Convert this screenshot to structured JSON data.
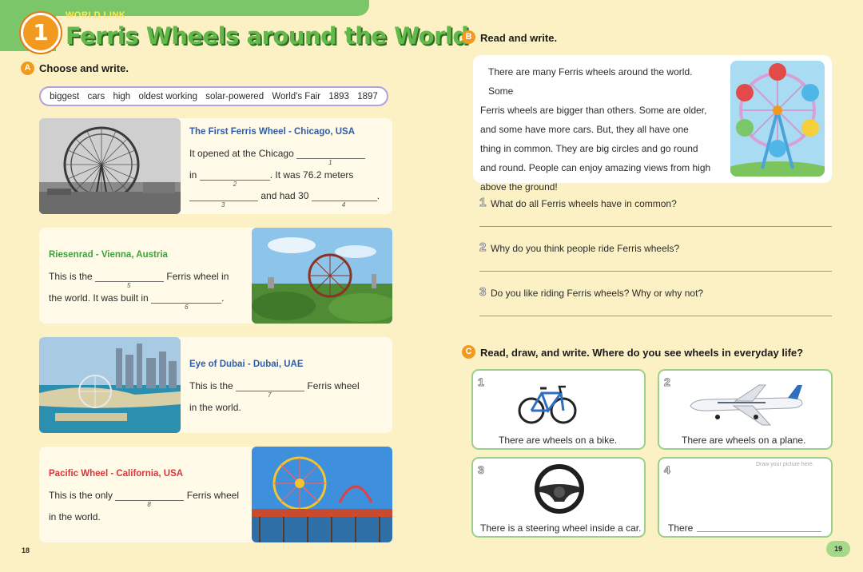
{
  "header": {
    "unit_number": "1",
    "series_label": "WORLD LINK",
    "title": "Ferris Wheels around the World"
  },
  "section_a": {
    "letter": "A",
    "instruction": "Choose and write."
  },
  "word_bank": [
    "biggest",
    "cars",
    "high",
    "oldest working",
    "solar-powered",
    "World's Fair",
    "1893",
    "1897"
  ],
  "cards": {
    "chicago": {
      "title": "The First Ferris Wheel - Chicago, USA",
      "l1a": "It opened at the Chicago",
      "n1": "1",
      "l2a": "in",
      "n2": "2",
      "l2b": ". It was 76.2 meters",
      "n3": "3",
      "l3b": "and had 30",
      "n4": "4",
      "l3c": "."
    },
    "vienna": {
      "title": "Riesenrad - Vienna, Austria",
      "l1a": "This is the",
      "n5": "5",
      "l1b": "Ferris wheel in",
      "l2a": "the world. It was built in",
      "n6": "6",
      "l2b": "."
    },
    "dubai": {
      "title": "Eye of Dubai - Dubai, UAE",
      "l1a": "This is the",
      "n7": "7",
      "l1b": "Ferris wheel",
      "l2a": "in the world."
    },
    "pacific": {
      "title": "Pacific Wheel - California, USA",
      "l1a": "This is the only",
      "n8": "8",
      "l1b": "Ferris wheel",
      "l2a": "in the world."
    }
  },
  "section_b": {
    "letter": "B",
    "instruction": "Read and write.",
    "passage": [
      "There are many Ferris wheels around the world. Some",
      "Ferris wheels are bigger than others. Some are older,",
      "and some have more cars. But, they all have one",
      "thing in common. They are big circles and go round",
      "and round. People can enjoy amazing views from high",
      "above the ground!"
    ],
    "questions": [
      {
        "num": "1",
        "text": "What do all Ferris wheels have in common?"
      },
      {
        "num": "2",
        "text": "Why do you think people ride Ferris wheels?"
      },
      {
        "num": "3",
        "text": "Do you like riding Ferris wheels? Why or why not?"
      }
    ]
  },
  "section_c": {
    "letter": "C",
    "instruction": "Read, draw, and write. Where do you see wheels in everyday life?",
    "items": [
      {
        "num": "1",
        "caption": "There are wheels on a bike.",
        "icon": "bicycle-icon"
      },
      {
        "num": "2",
        "caption": "There are wheels on a plane.",
        "icon": "airplane-icon"
      },
      {
        "num": "3",
        "caption": "There is a steering wheel inside a car.",
        "icon": "steering-wheel-icon"
      },
      {
        "num": "4",
        "caption": "There",
        "hint": "Draw your picture here."
      }
    ]
  },
  "page_numbers": {
    "left": "18",
    "right": "19"
  },
  "colors": {
    "background": "#fbf1c4",
    "green": "#62b848",
    "orange": "#f29a1f",
    "blue_title": "#2f5da8",
    "red_title": "#d9353a"
  }
}
